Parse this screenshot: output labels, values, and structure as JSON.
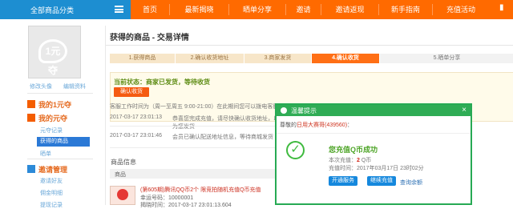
{
  "topbar": {
    "category_label": "全部商品分类",
    "nav": [
      "首页",
      "最新揭晓",
      "晒单分享",
      "邀请",
      "邀请返现",
      "新手指南",
      "充值活动"
    ],
    "more_label": "▮"
  },
  "sidebar": {
    "avatar_logo": "1元夺",
    "avatar_links": [
      "修改头像",
      "编辑资料"
    ],
    "sections": [
      {
        "title": "我的1元夺",
        "items": []
      },
      {
        "title": "我的元夺",
        "items": [
          "元夺记录",
          "获得的商品",
          "晒单"
        ]
      },
      {
        "title": "邀请管理",
        "items": [
          "邀请好友",
          "佣金明细",
          "提现记录"
        ]
      }
    ]
  },
  "main": {
    "title": "获得的商品 - 交易详情",
    "steps": [
      "1.获得商品",
      "2.确认收货地址",
      "3.商家发货",
      "4.确认收货",
      "5.晒单分享"
    ],
    "status": "当前状态：商家已发货，等待收货",
    "confirm_button": "确认收货",
    "service_note": "客服工作时间为（周一至周五 9:00-21:00）在此期间您可以拨电客服咨询，其余时间请在线留言",
    "logs": [
      {
        "time": "2017-03-17 23:01:13",
        "desc": "恭喜您完成充值，请尽快确认收货地址，以便我们为您发货"
      },
      {
        "time": "2017-03-17 23:01:46",
        "desc": "会员已确认配送地址信息，等待商城发货"
      }
    ],
    "goods_title": "商品信息",
    "goods_head": "商品",
    "goods": {
      "name": "(第605期)腾讯QQ币2个 限竞拍随机充值Q币充值",
      "number": "幸运号码：10000001",
      "time": "揭晓时间：2017-03-17 23:01:13.604"
    }
  },
  "popup": {
    "title": "温馨提示",
    "message_prefix": "尊敬的",
    "message_link": "日用大赛哥(439560)",
    "message_suffix": "：",
    "success": "您充值Q币成功",
    "recharge_prefix": "本次充值：",
    "recharge_amount": "2",
    "recharge_unit": " Q币",
    "recharge_time": "充值时间：2017年03月17日 23时02分",
    "buttons": [
      "开通服务",
      "继续充值"
    ],
    "link": "查询余额"
  },
  "colors": {
    "orange": "#ff6a00",
    "blue": "#1d8ed1",
    "green": "#2fac55"
  }
}
